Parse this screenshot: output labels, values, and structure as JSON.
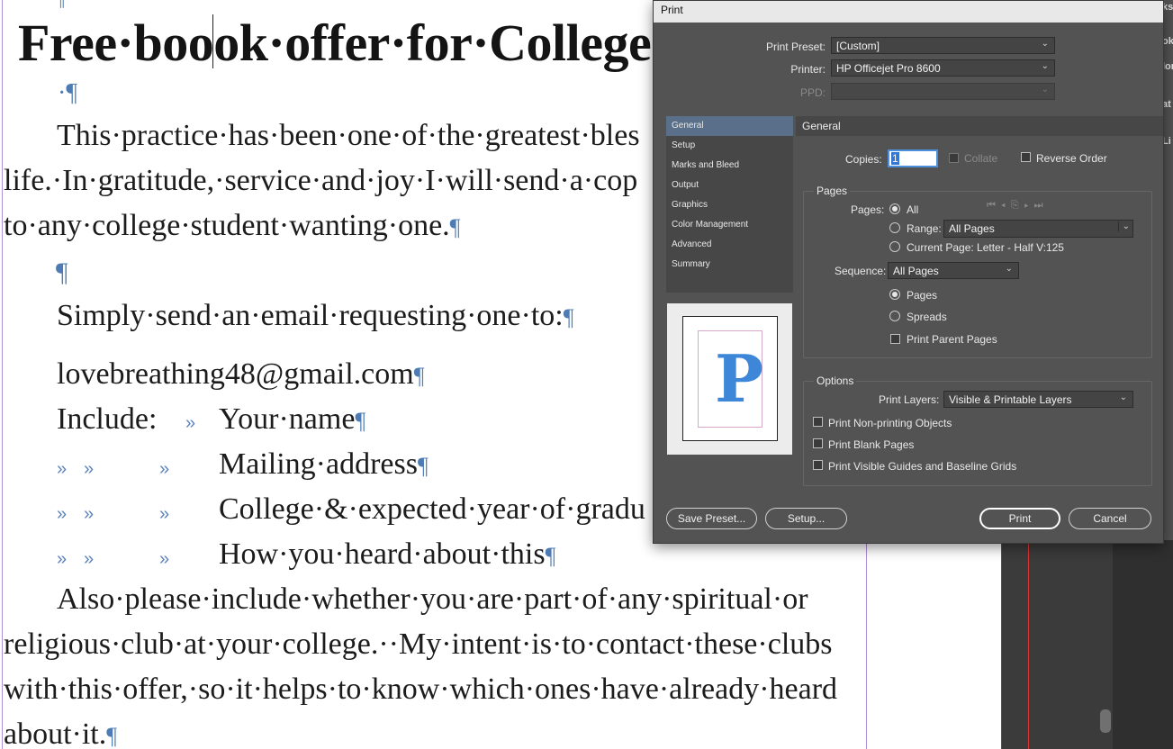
{
  "document": {
    "title_line": "Free·boook·offer·for·College",
    "title_pilcrow": "¶",
    "empty_pilcrow_1": "·¶",
    "para1_line1": "This·practice·has·been·one·of·the·greatest·bles",
    "para1_line2": "life.·In·gratitude,·service·and·joy·I·will·send·a·cop",
    "para1_line3": "to·any·college·student·wanting·one.",
    "empty_pilcrow_2": "¶",
    "request_line": "Simply·send·an·email·requesting·one·to:",
    "email_line": "lovebreathing48@gmail.com",
    "include_label": "Include:",
    "list_items": [
      "Your·name",
      "Mailing·address",
      "College·&·expected·year·of·gradu",
      "How·you·heard·about·this"
    ],
    "tab_marker": "»",
    "pilcrow": "¶",
    "para2_line1": "Also·please·include·whether·you·are·part·of·any·spiritual·or",
    "para2_line2": "religious·club·at·your·college.··My·intent·is·to·contact·these·clubs",
    "para2_line3": "with·this·offer,·so·it·helps·to·know·which·ones·have·already·heard",
    "para2_line4": "about·it."
  },
  "side_tabs": [
    "ks",
    "ok",
    "lor",
    "at",
    "Li"
  ],
  "dialog": {
    "title": "Print",
    "print_preset_label": "Print Preset:",
    "print_preset_value": "[Custom]",
    "printer_label": "Printer:",
    "printer_value": "HP Officejet Pro 8600",
    "ppd_label": "PPD:",
    "ppd_value": "",
    "nav_items": [
      "General",
      "Setup",
      "Marks and Bleed",
      "Output",
      "Graphics",
      "Color Management",
      "Advanced",
      "Summary"
    ],
    "selected_nav": "General",
    "section_title": "General",
    "preview_letter": "P",
    "copies_label": "Copies:",
    "copies_value": "1",
    "collate_label": "Collate",
    "reverse_order_label": "Reverse Order",
    "pages_group": {
      "title": "Pages",
      "pages_label": "Pages:",
      "all_label": "All",
      "range_label": "Range:",
      "range_value": "All Pages",
      "current_page_label": "Current Page: Letter - Half V:125",
      "sequence_label": "Sequence:",
      "sequence_value": "All Pages",
      "pages_radio_label": "Pages",
      "spreads_radio_label": "Spreads",
      "print_parent_pages_label": "Print Parent Pages",
      "selected_scope": "All",
      "selected_layout": "Pages"
    },
    "options_group": {
      "title": "Options",
      "print_layers_label": "Print Layers:",
      "print_layers_value": "Visible & Printable Layers",
      "non_printing_label": "Print Non-printing Objects",
      "blank_pages_label": "Print Blank Pages",
      "guides_label": "Print Visible Guides and Baseline Grids"
    },
    "buttons": {
      "save_preset": "Save Preset...",
      "setup": "Setup...",
      "print": "Print",
      "cancel": "Cancel"
    }
  },
  "colors": {
    "dialog_bg": "#535353",
    "nav_selected": "#5a6f89",
    "hidden_char_blue": "#4d7bb3",
    "margin_guide": "#b38fd6"
  }
}
